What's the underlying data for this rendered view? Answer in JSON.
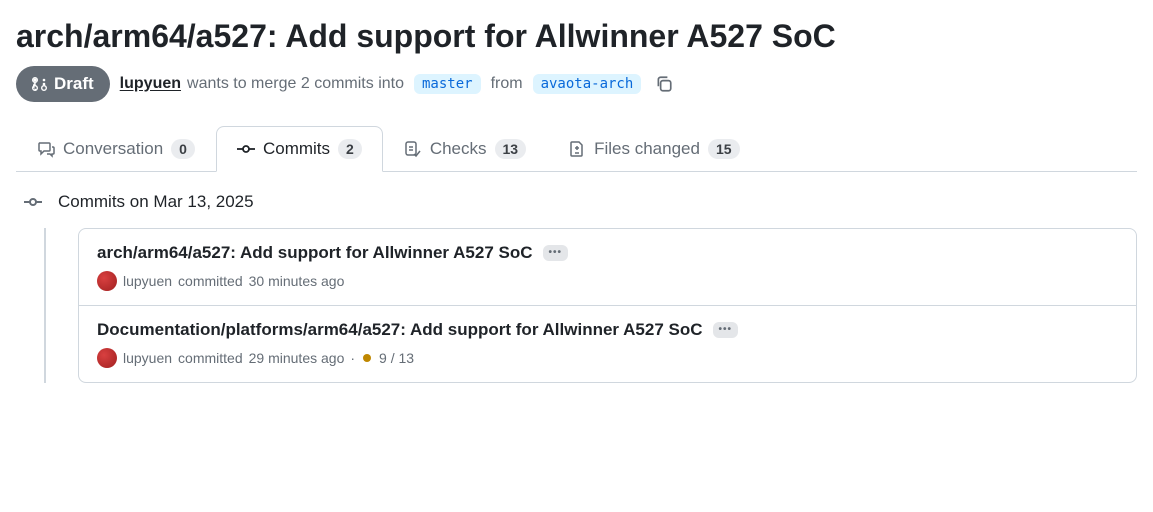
{
  "title": "arch/arm64/a527: Add support for Allwinner A527 SoC",
  "badge": "Draft",
  "author": "lupyuen",
  "merge_text_pre": "wants to merge 2 commits into",
  "base_branch": "master",
  "merge_text_from": "from",
  "head_branch": "avaota-arch",
  "tabs": {
    "conversation": {
      "label": "Conversation",
      "count": "0"
    },
    "commits": {
      "label": "Commits",
      "count": "2"
    },
    "checks": {
      "label": "Checks",
      "count": "13"
    },
    "files": {
      "label": "Files changed",
      "count": "15"
    }
  },
  "date_header": "Commits on Mar 13, 2025",
  "commits": [
    {
      "title": "arch/arm64/a527: Add support for Allwinner A527 SoC",
      "author": "lupyuen",
      "committed_text": "committed",
      "time": "30 minutes ago",
      "status": null
    },
    {
      "title": "Documentation/platforms/arm64/a527: Add support for Allwinner A527 SoC",
      "author": "lupyuen",
      "committed_text": "committed",
      "time": "29 minutes ago",
      "status": "9 / 13"
    }
  ]
}
